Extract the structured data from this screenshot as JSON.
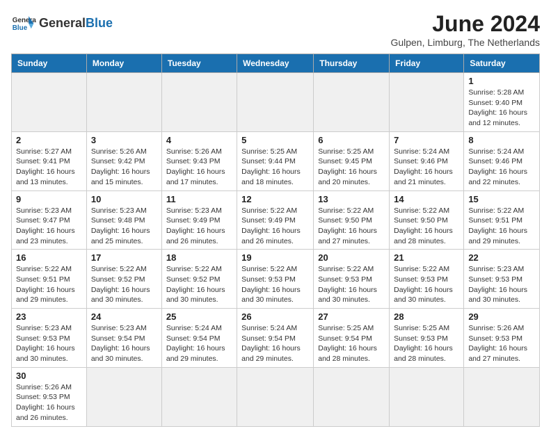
{
  "header": {
    "logo_general": "General",
    "logo_blue": "Blue",
    "month": "June 2024",
    "location": "Gulpen, Limburg, The Netherlands"
  },
  "days_of_week": [
    "Sunday",
    "Monday",
    "Tuesday",
    "Wednesday",
    "Thursday",
    "Friday",
    "Saturday"
  ],
  "weeks": [
    [
      {
        "day": "",
        "info": ""
      },
      {
        "day": "",
        "info": ""
      },
      {
        "day": "",
        "info": ""
      },
      {
        "day": "",
        "info": ""
      },
      {
        "day": "",
        "info": ""
      },
      {
        "day": "",
        "info": ""
      },
      {
        "day": "1",
        "info": "Sunrise: 5:28 AM\nSunset: 9:40 PM\nDaylight: 16 hours and 12 minutes."
      }
    ],
    [
      {
        "day": "2",
        "info": "Sunrise: 5:27 AM\nSunset: 9:41 PM\nDaylight: 16 hours and 13 minutes."
      },
      {
        "day": "3",
        "info": "Sunrise: 5:26 AM\nSunset: 9:42 PM\nDaylight: 16 hours and 15 minutes."
      },
      {
        "day": "4",
        "info": "Sunrise: 5:26 AM\nSunset: 9:43 PM\nDaylight: 16 hours and 17 minutes."
      },
      {
        "day": "5",
        "info": "Sunrise: 5:25 AM\nSunset: 9:44 PM\nDaylight: 16 hours and 18 minutes."
      },
      {
        "day": "6",
        "info": "Sunrise: 5:25 AM\nSunset: 9:45 PM\nDaylight: 16 hours and 20 minutes."
      },
      {
        "day": "7",
        "info": "Sunrise: 5:24 AM\nSunset: 9:46 PM\nDaylight: 16 hours and 21 minutes."
      },
      {
        "day": "8",
        "info": "Sunrise: 5:24 AM\nSunset: 9:46 PM\nDaylight: 16 hours and 22 minutes."
      }
    ],
    [
      {
        "day": "9",
        "info": "Sunrise: 5:23 AM\nSunset: 9:47 PM\nDaylight: 16 hours and 23 minutes."
      },
      {
        "day": "10",
        "info": "Sunrise: 5:23 AM\nSunset: 9:48 PM\nDaylight: 16 hours and 25 minutes."
      },
      {
        "day": "11",
        "info": "Sunrise: 5:23 AM\nSunset: 9:49 PM\nDaylight: 16 hours and 26 minutes."
      },
      {
        "day": "12",
        "info": "Sunrise: 5:22 AM\nSunset: 9:49 PM\nDaylight: 16 hours and 26 minutes."
      },
      {
        "day": "13",
        "info": "Sunrise: 5:22 AM\nSunset: 9:50 PM\nDaylight: 16 hours and 27 minutes."
      },
      {
        "day": "14",
        "info": "Sunrise: 5:22 AM\nSunset: 9:50 PM\nDaylight: 16 hours and 28 minutes."
      },
      {
        "day": "15",
        "info": "Sunrise: 5:22 AM\nSunset: 9:51 PM\nDaylight: 16 hours and 29 minutes."
      }
    ],
    [
      {
        "day": "16",
        "info": "Sunrise: 5:22 AM\nSunset: 9:51 PM\nDaylight: 16 hours and 29 minutes."
      },
      {
        "day": "17",
        "info": "Sunrise: 5:22 AM\nSunset: 9:52 PM\nDaylight: 16 hours and 30 minutes."
      },
      {
        "day": "18",
        "info": "Sunrise: 5:22 AM\nSunset: 9:52 PM\nDaylight: 16 hours and 30 minutes."
      },
      {
        "day": "19",
        "info": "Sunrise: 5:22 AM\nSunset: 9:53 PM\nDaylight: 16 hours and 30 minutes."
      },
      {
        "day": "20",
        "info": "Sunrise: 5:22 AM\nSunset: 9:53 PM\nDaylight: 16 hours and 30 minutes."
      },
      {
        "day": "21",
        "info": "Sunrise: 5:22 AM\nSunset: 9:53 PM\nDaylight: 16 hours and 30 minutes."
      },
      {
        "day": "22",
        "info": "Sunrise: 5:23 AM\nSunset: 9:53 PM\nDaylight: 16 hours and 30 minutes."
      }
    ],
    [
      {
        "day": "23",
        "info": "Sunrise: 5:23 AM\nSunset: 9:53 PM\nDaylight: 16 hours and 30 minutes."
      },
      {
        "day": "24",
        "info": "Sunrise: 5:23 AM\nSunset: 9:54 PM\nDaylight: 16 hours and 30 minutes."
      },
      {
        "day": "25",
        "info": "Sunrise: 5:24 AM\nSunset: 9:54 PM\nDaylight: 16 hours and 29 minutes."
      },
      {
        "day": "26",
        "info": "Sunrise: 5:24 AM\nSunset: 9:54 PM\nDaylight: 16 hours and 29 minutes."
      },
      {
        "day": "27",
        "info": "Sunrise: 5:25 AM\nSunset: 9:54 PM\nDaylight: 16 hours and 28 minutes."
      },
      {
        "day": "28",
        "info": "Sunrise: 5:25 AM\nSunset: 9:53 PM\nDaylight: 16 hours and 28 minutes."
      },
      {
        "day": "29",
        "info": "Sunrise: 5:26 AM\nSunset: 9:53 PM\nDaylight: 16 hours and 27 minutes."
      }
    ],
    [
      {
        "day": "30",
        "info": "Sunrise: 5:26 AM\nSunset: 9:53 PM\nDaylight: 16 hours and 26 minutes."
      },
      {
        "day": "",
        "info": ""
      },
      {
        "day": "",
        "info": ""
      },
      {
        "day": "",
        "info": ""
      },
      {
        "day": "",
        "info": ""
      },
      {
        "day": "",
        "info": ""
      },
      {
        "day": "",
        "info": ""
      }
    ]
  ]
}
